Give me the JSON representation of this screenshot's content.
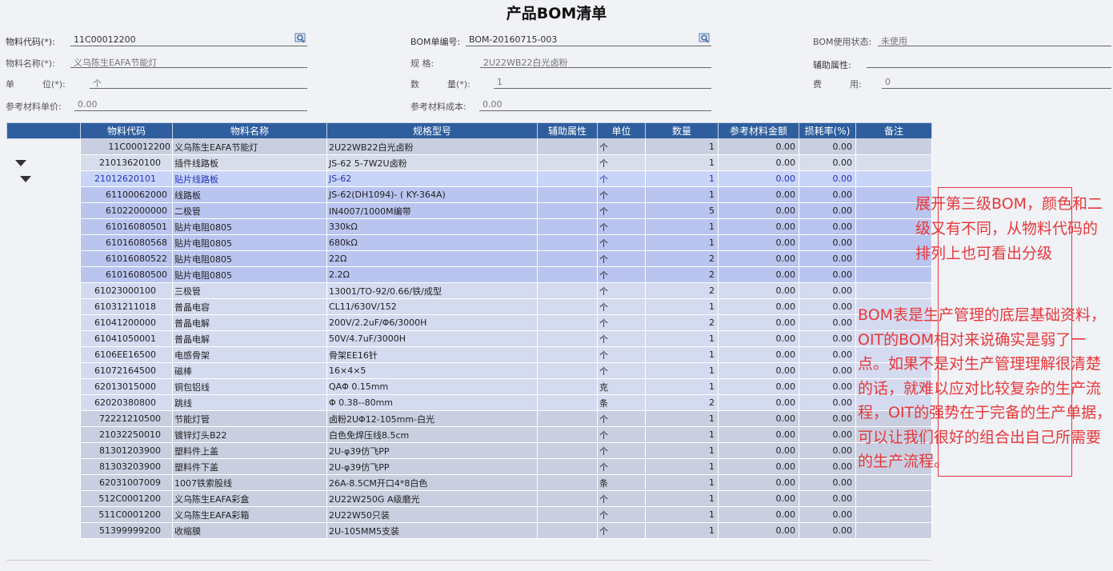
{
  "title": "产品BOM清单",
  "header": {
    "material_code_label": "物料代码(*):",
    "material_code_value": "11C00012200",
    "material_name_label": "物料名称(*):",
    "material_name_value": "义乌陈生EAFA节能灯",
    "unit_label": "单          位(*):",
    "unit_value": "个",
    "ref_price_label": "参考材料单价:",
    "ref_price_value": "0.00",
    "bom_no_label": "BOM单编号:",
    "bom_no_value": "BOM-20160715-003",
    "spec_label": "规          格:",
    "spec_value": "2U22WB22白光卤粉",
    "qty_label": "数          量(*):",
    "qty_value": "1",
    "ref_cost_label": "参考材料成本:",
    "ref_cost_value": "0.00",
    "bom_status_label": "BOM使用状态:",
    "bom_status_value": "未使用",
    "aux_label": "辅助属性:",
    "aux_value": "",
    "fee_label": "费          用:",
    "fee_value": "0"
  },
  "table": {
    "columns": [
      "物料代码",
      "物料名称",
      "规格型号",
      "辅助属性",
      "单位",
      "数量",
      "参考材料金额",
      "损耗率(%)",
      "备注"
    ],
    "rows": [
      {
        "code": "11C00012200",
        "name": "义乌陈生EAFA节能灯",
        "spec": "2U22WB22白光卤粉",
        "aux": "",
        "unit": "个",
        "qty": "1",
        "amt": "0.00",
        "loss": "0.00",
        "note": ""
      },
      {
        "code": "21013620100",
        "name": "插件线路板",
        "spec": "JS-62 5-7W2U卤粉",
        "aux": "",
        "unit": "个",
        "qty": "1",
        "amt": "0.00",
        "loss": "0.00",
        "note": ""
      },
      {
        "code": "21012620101",
        "name": "贴片线路板",
        "spec": "JS-62",
        "aux": "",
        "unit": "个",
        "qty": "1",
        "amt": "0.00",
        "loss": "0.00",
        "note": ""
      },
      {
        "code": "61100062000",
        "name": "线路板",
        "spec": "JS-62(DH1094)- ( KY-364A)",
        "aux": "",
        "unit": "个",
        "qty": "1",
        "amt": "0.00",
        "loss": "0.00",
        "note": ""
      },
      {
        "code": "61022000000",
        "name": "二极管",
        "spec": "IN4007/1000M编带",
        "aux": "",
        "unit": "个",
        "qty": "5",
        "amt": "0.00",
        "loss": "0.00",
        "note": ""
      },
      {
        "code": "61016080501",
        "name": "贴片电阻0805",
        "spec": "330kΩ",
        "aux": "",
        "unit": "个",
        "qty": "1",
        "amt": "0.00",
        "loss": "0.00",
        "note": ""
      },
      {
        "code": "61016080568",
        "name": "贴片电阻0805",
        "spec": "680kΩ",
        "aux": "",
        "unit": "个",
        "qty": "1",
        "amt": "0.00",
        "loss": "0.00",
        "note": ""
      },
      {
        "code": "61016080522",
        "name": "贴片电阻0805",
        "spec": "22Ω",
        "aux": "",
        "unit": "个",
        "qty": "2",
        "amt": "0.00",
        "loss": "0.00",
        "note": ""
      },
      {
        "code": "61016080500",
        "name": "贴片电阻0805",
        "spec": "2.2Ω",
        "aux": "",
        "unit": "个",
        "qty": "2",
        "amt": "0.00",
        "loss": "0.00",
        "note": ""
      },
      {
        "code": "61023000100",
        "name": "三极管",
        "spec": "13001/TO-92/0.66/铁/成型",
        "aux": "",
        "unit": "个",
        "qty": "2",
        "amt": "0.00",
        "loss": "0.00",
        "note": ""
      },
      {
        "code": "61031211018",
        "name": "普晶电容",
        "spec": "CL11/630V/152",
        "aux": "",
        "unit": "个",
        "qty": "1",
        "amt": "0.00",
        "loss": "0.00",
        "note": ""
      },
      {
        "code": "61041200000",
        "name": "普晶电解",
        "spec": "200V/2.2uF/Φ6/3000H",
        "aux": "",
        "unit": "个",
        "qty": "2",
        "amt": "0.00",
        "loss": "0.00",
        "note": ""
      },
      {
        "code": "61041050001",
        "name": "普晶电解",
        "spec": "50V/4.7uF/3000H",
        "aux": "",
        "unit": "个",
        "qty": "1",
        "amt": "0.00",
        "loss": "0.00",
        "note": ""
      },
      {
        "code": "6106EE16500",
        "name": "电感骨架",
        "spec": "骨架EE16针",
        "aux": "",
        "unit": "个",
        "qty": "1",
        "amt": "0.00",
        "loss": "0.00",
        "note": ""
      },
      {
        "code": "61072164500",
        "name": "磁棒",
        "spec": "16×4×5",
        "aux": "",
        "unit": "个",
        "qty": "1",
        "amt": "0.00",
        "loss": "0.00",
        "note": ""
      },
      {
        "code": "62013015000",
        "name": "铜包铝线",
        "spec": "QAΦ 0.15mm",
        "aux": "",
        "unit": "克",
        "qty": "1",
        "amt": "0.00",
        "loss": "0.00",
        "note": ""
      },
      {
        "code": "62020380800",
        "name": "跳线",
        "spec": "Φ 0.38--80mm",
        "aux": "",
        "unit": "条",
        "qty": "2",
        "amt": "0.00",
        "loss": "0.00",
        "note": ""
      },
      {
        "code": "72221210500",
        "name": "节能灯管",
        "spec": "卤粉2UΦ12-105mm-白光",
        "aux": "",
        "unit": "个",
        "qty": "1",
        "amt": "0.00",
        "loss": "0.00",
        "note": ""
      },
      {
        "code": "21032250010",
        "name": "镀锌灯头B22",
        "spec": "白色免焊压线8.5cm",
        "aux": "",
        "unit": "个",
        "qty": "1",
        "amt": "0.00",
        "loss": "0.00",
        "note": ""
      },
      {
        "code": "81301203900",
        "name": "塑料件上盖",
        "spec": "2U-φ39仿飞PP",
        "aux": "",
        "unit": "个",
        "qty": "1",
        "amt": "0.00",
        "loss": "0.00",
        "note": ""
      },
      {
        "code": "81303203900",
        "name": "塑料件下盖",
        "spec": "2U-φ39仿飞PP",
        "aux": "",
        "unit": "个",
        "qty": "1",
        "amt": "0.00",
        "loss": "0.00",
        "note": ""
      },
      {
        "code": "62031007009",
        "name": "1007铁索股线",
        "spec": "26A-8.5CM开口4*8白色",
        "aux": "",
        "unit": "条",
        "qty": "1",
        "amt": "0.00",
        "loss": "0.00",
        "note": ""
      },
      {
        "code": "512C0001200",
        "name": "义乌陈生EAFA彩盒",
        "spec": "2U22W250G A级磨光",
        "aux": "",
        "unit": "个",
        "qty": "1",
        "amt": "0.00",
        "loss": "0.00",
        "note": ""
      },
      {
        "code": "511C0001200",
        "name": "义乌陈生EAFA彩箱",
        "spec": "2U22W50只装",
        "aux": "",
        "unit": "个",
        "qty": "1",
        "amt": "0.00",
        "loss": "0.00",
        "note": ""
      },
      {
        "code": "51399999200",
        "name": "收缩膜",
        "spec": "2U-105MM5支装",
        "aux": "",
        "unit": "个",
        "qty": "1",
        "amt": "0.00",
        "loss": "0.00",
        "note": ""
      }
    ]
  },
  "annotations": {
    "note1": "展开第三级BOM，颜色和二级又有不同，从物料代码的排列上也可看出分级",
    "note2": "BOM表是生产管理的底层基础资料，OIT的BOM相对来说确实是弱了一点。如果不是对生产管理理解很清楚的话，就难以应对比较复杂的生产流程，OIT的强势在于完备的生产单据，可以让我们很好的组合出自己所需要的生产流程。"
  },
  "colors": {
    "header_bg": "#2e5e9e",
    "annotation": "#e8373a"
  },
  "icons": [
    "search-lookup-icon",
    "expand-triangle-icon"
  ]
}
